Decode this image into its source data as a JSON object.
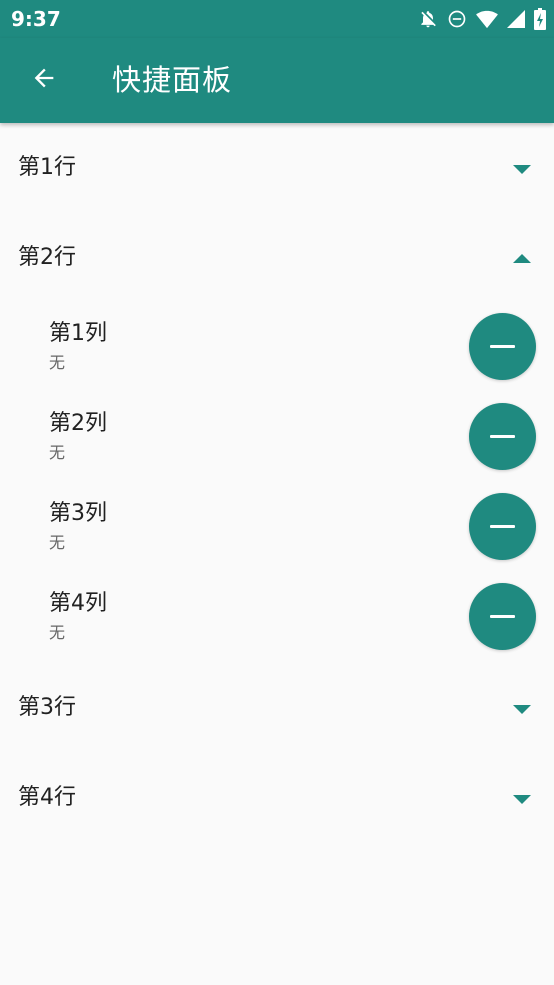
{
  "status_bar": {
    "time": "9:37",
    "icons": [
      "notifications-off-icon",
      "do-not-disturb-icon",
      "wifi-icon",
      "signal-icon",
      "battery-charging-icon"
    ]
  },
  "app_bar": {
    "back_icon": "arrow-back-icon",
    "title": "快捷面板"
  },
  "rows": [
    {
      "label": "第1行",
      "expanded": false
    },
    {
      "label": "第2行",
      "expanded": true,
      "columns": [
        {
          "title": "第1列",
          "value": "无"
        },
        {
          "title": "第2列",
          "value": "无"
        },
        {
          "title": "第3列",
          "value": "无"
        },
        {
          "title": "第4列",
          "value": "无"
        }
      ]
    },
    {
      "label": "第3行",
      "expanded": false
    },
    {
      "label": "第4行",
      "expanded": false
    }
  ],
  "colors": {
    "primary": "#1f8a80",
    "background": "#fafafa",
    "text": "#212121",
    "secondary_text": "#666666"
  }
}
